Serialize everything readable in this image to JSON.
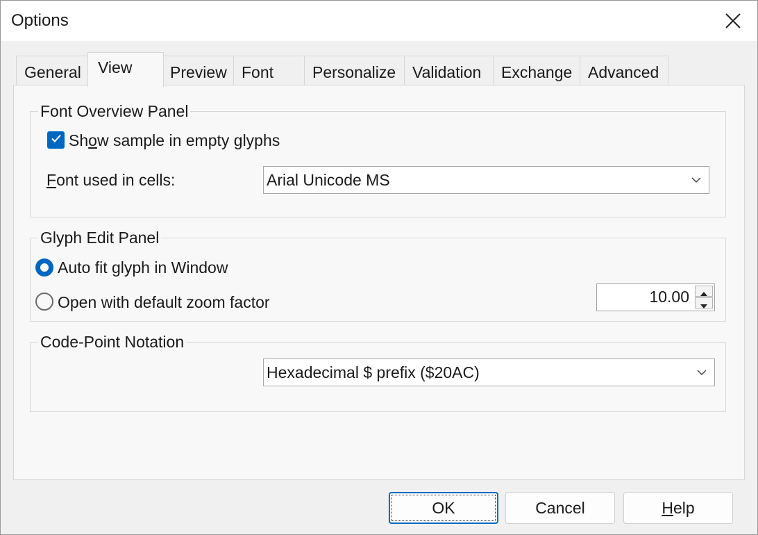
{
  "window": {
    "title": "Options",
    "close_icon": "close-icon"
  },
  "tabs": [
    {
      "label": "General",
      "active": false
    },
    {
      "label": "View",
      "active": true
    },
    {
      "label": "Preview",
      "active": false
    },
    {
      "label": "Font",
      "active": false
    },
    {
      "label": "Personalize",
      "active": false
    },
    {
      "label": "Validation",
      "active": false
    },
    {
      "label": "Exchange",
      "active": false
    },
    {
      "label": "Advanced",
      "active": false
    }
  ],
  "font_overview": {
    "legend": "Font Overview Panel",
    "show_sample": {
      "label_pre": "Sh",
      "label_key": "o",
      "label_post": "w sample in empty glyphs",
      "checked": true
    },
    "font_cells": {
      "label_key": "F",
      "label_post": "ont used in cells:",
      "value": "Arial Unicode MS"
    }
  },
  "glyph_edit": {
    "legend": "Glyph Edit Panel",
    "auto_fit": {
      "label": "Auto fit glyph in Window",
      "selected": true
    },
    "default_zoom": {
      "label": "Open with default zoom factor",
      "selected": false
    },
    "zoom_value": "10.00"
  },
  "code_point": {
    "legend": "Code-Point Notation",
    "value": "Hexadecimal $ prefix ($20AC)"
  },
  "buttons": {
    "ok": "OK",
    "cancel": "Cancel",
    "help_key": "H",
    "help_post": "elp"
  },
  "colors": {
    "accent": "#0067c0"
  }
}
